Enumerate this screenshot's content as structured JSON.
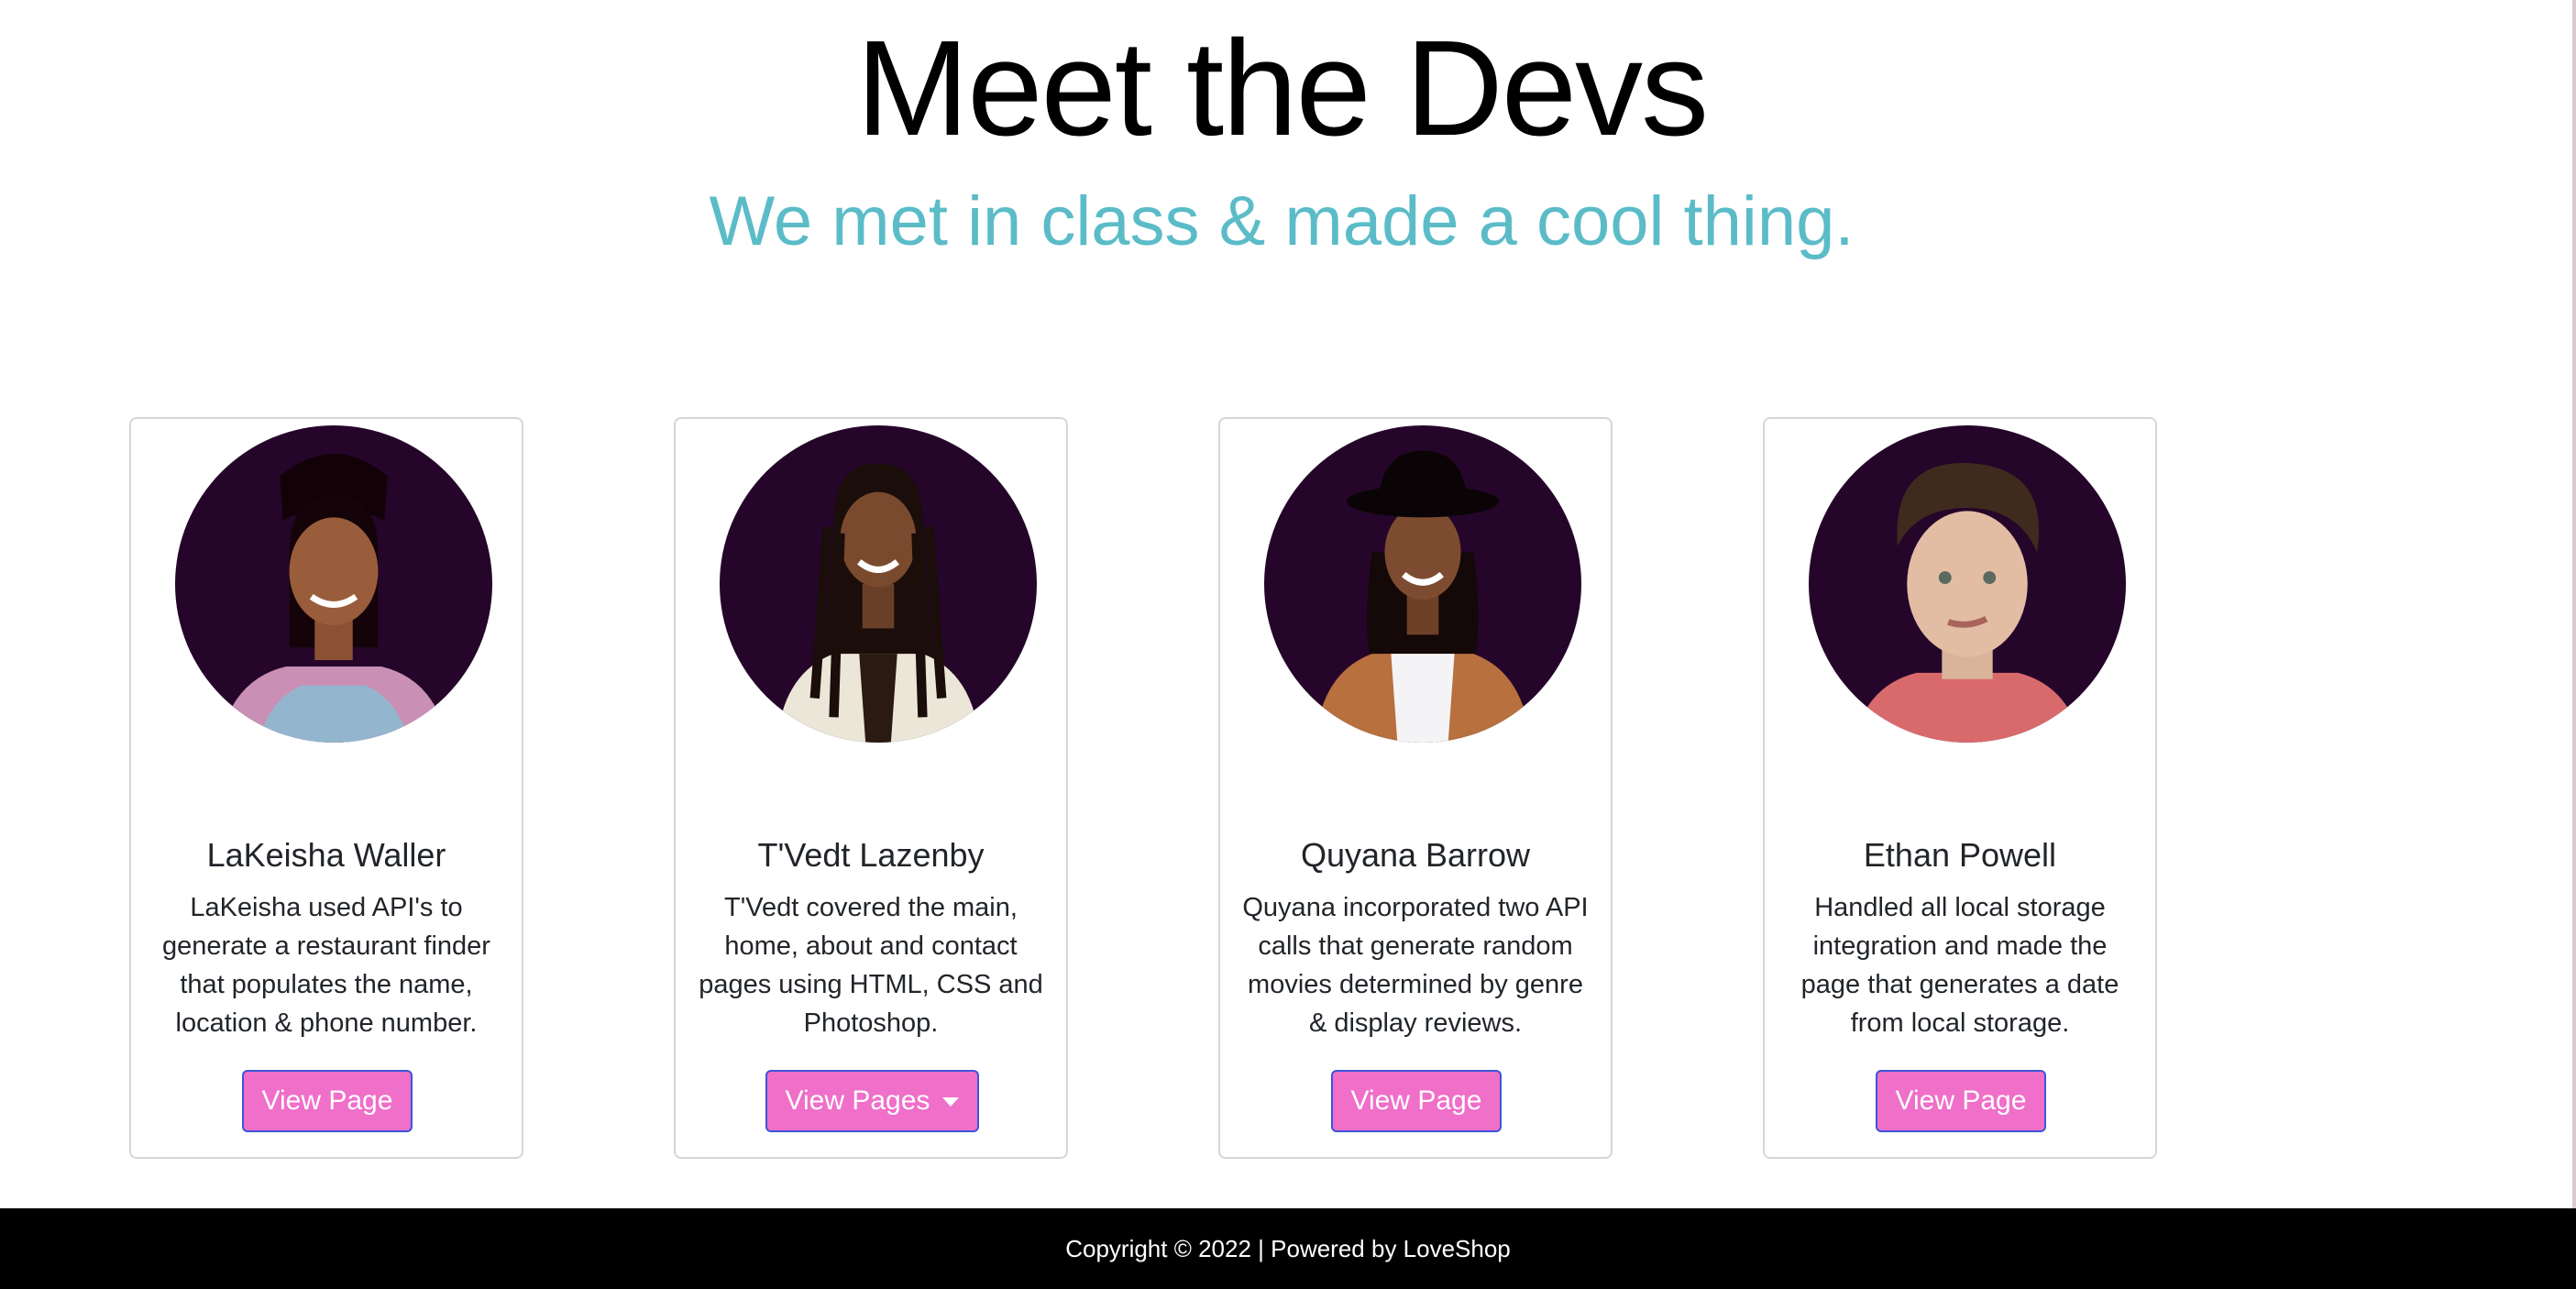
{
  "header": {
    "title": "Meet the Devs",
    "subtitle": "We met in class & made a cool thing."
  },
  "devs": [
    {
      "name": "LaKeisha Waller",
      "description": "LaKeisha used API's to generate a restaurant finder that populates the name, location & phone number.",
      "button": "View Page"
    },
    {
      "name": "T'Vedt Lazenby",
      "description": "T'Vedt covered the main, home, about and contact pages using HTML, CSS and Photoshop.",
      "button": "View Pages"
    },
    {
      "name": "Quyana Barrow",
      "description": "Quyana incorporated two API calls that generate random movies determined by genre & display reviews.",
      "button": "View Page"
    },
    {
      "name": "Ethan Powell",
      "description": "Handled all local storage integration and made the page that generates a date from local storage.",
      "button": "View Page"
    }
  ],
  "footer": {
    "text": "Copyright © 2022 | Powered by LoveShop"
  },
  "colors": {
    "accent_subtitle": "#5bbcc8",
    "button_bg": "#ef6fc9",
    "button_border": "#3d55d8",
    "avatar_bg": "#25062a",
    "footer_bg": "#000000"
  }
}
